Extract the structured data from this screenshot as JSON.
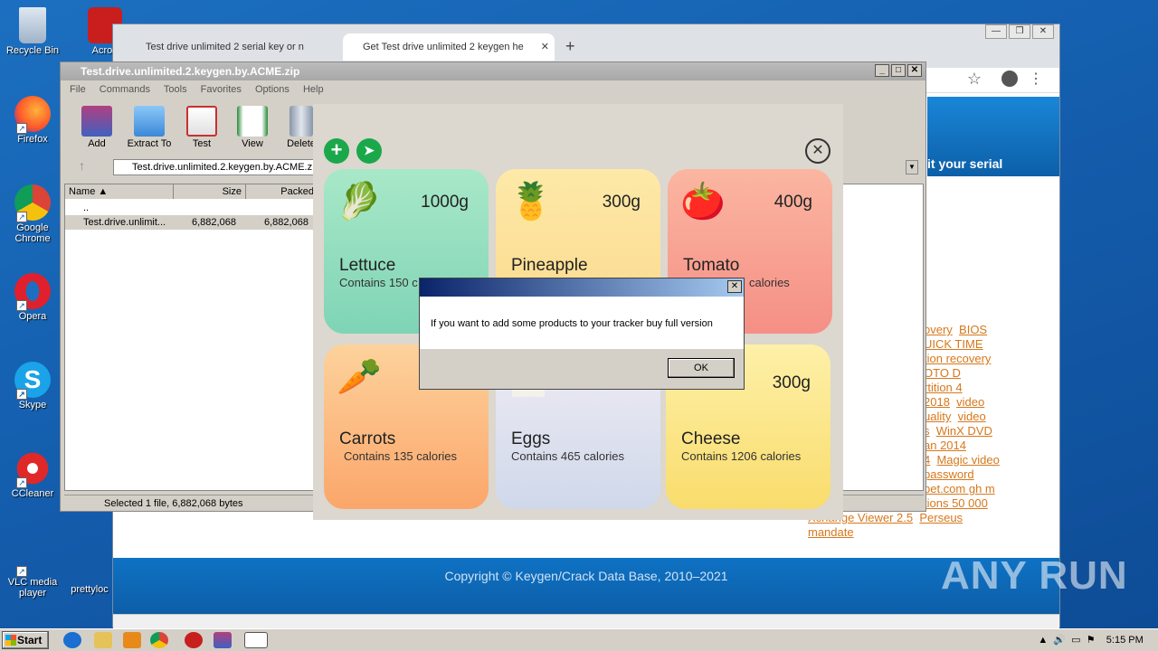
{
  "desktop": {
    "icons": [
      {
        "label": "Recycle Bin",
        "icon": "recycle-bin-icon"
      },
      {
        "label": "Firefox",
        "icon": "firefox-icon"
      },
      {
        "label": "Google Chrome",
        "icon": "chrome-icon"
      },
      {
        "label": "Opera",
        "icon": "opera-icon"
      },
      {
        "label": "Skype",
        "icon": "skype-icon"
      },
      {
        "label": "CCleaner",
        "icon": "ccleaner-icon"
      },
      {
        "label": "VLC media player",
        "icon": "vlc-icon"
      }
    ],
    "partial_icons": [
      "Acrob",
      "prettyloc"
    ]
  },
  "browser": {
    "tabs": [
      {
        "label": "Test drive unlimited 2 serial key or n"
      },
      {
        "label": "Get Test drive unlimited 2 keygen he"
      }
    ],
    "window_controls": [
      "—",
      "❐",
      "✕"
    ],
    "banner_text": "it your serial",
    "links": [
      "overy",
      "BIOS",
      "UICK TIME",
      "tion recovery",
      "OTO D",
      "rtition 4",
      "2018",
      "video",
      "uality",
      "video",
      "s",
      "WinX DVD",
      "an 2014",
      "4",
      "Magic video",
      "password",
      "bet.com gh m",
      "tions 50 000",
      "Xchange Viewer 2.5",
      "Perseus",
      "mandate"
    ],
    "footer": "Copyright © Keygen/Crack Data Base, 2010–2021"
  },
  "winrar": {
    "title": "Test.drive.unlimited.2.keygen.by.ACME.zip",
    "menu": [
      "File",
      "Commands",
      "Tools",
      "Favorites",
      "Options",
      "Help"
    ],
    "toolbar": [
      "Add",
      "Extract To",
      "Test",
      "View",
      "Delete"
    ],
    "path": "Test.drive.unlimited.2.keygen.by.ACME.z",
    "columns": [
      "Name",
      "Size",
      "Packed"
    ],
    "rows": [
      {
        "name": "..",
        "size": "",
        "packed": ""
      },
      {
        "name": "Test.drive.unlimit...",
        "size": "6,882,068",
        "packed": "6,882,068"
      }
    ],
    "status": "Selected 1 file, 6,882,068 bytes"
  },
  "tracker": {
    "cards": [
      {
        "name": "Lettuce",
        "weight": "1000g",
        "calories": "Contains 150 c",
        "icon": "lettuce-icon",
        "emoji": "🥬",
        "color1": "#a8e8c8",
        "color2": "#7fd4b6"
      },
      {
        "name": "Pineapple",
        "weight": "300g",
        "calories": "",
        "icon": "pineapple-icon",
        "emoji": "🍍",
        "color1": "#fde9a8",
        "color2": "#fbd98c"
      },
      {
        "name": "Tomato",
        "weight": "400g",
        "calories": "calories",
        "icon": "tomato-icon",
        "emoji": "🍅",
        "color1": "#fbb6a0",
        "color2": "#f58f86"
      },
      {
        "name": "Carrots",
        "weight": "",
        "calories": "Contains 135 calories",
        "icon": "carrot-icon",
        "emoji": "🥕",
        "color1": "#fdd29c",
        "color2": "#fba66a"
      },
      {
        "name": "Eggs",
        "weight": "",
        "calories": "Contains 465 calories",
        "icon": "egg-icon",
        "emoji": "",
        "color1": "#f0ecf4",
        "color2": "#cfd8ea"
      },
      {
        "name": "Cheese",
        "weight": "300g",
        "calories": "Contains 1206 calories",
        "icon": "cheese-icon",
        "emoji": "",
        "color1": "#fdf0a8",
        "color2": "#f9dc6c"
      }
    ]
  },
  "dialog": {
    "message": "If you want to add some products to your tracker buy full version",
    "ok_label": "OK",
    "close": "✕"
  },
  "taskbar": {
    "start_label": "Start",
    "clock": "5:15 PM"
  },
  "watermark": "ANY RUN"
}
